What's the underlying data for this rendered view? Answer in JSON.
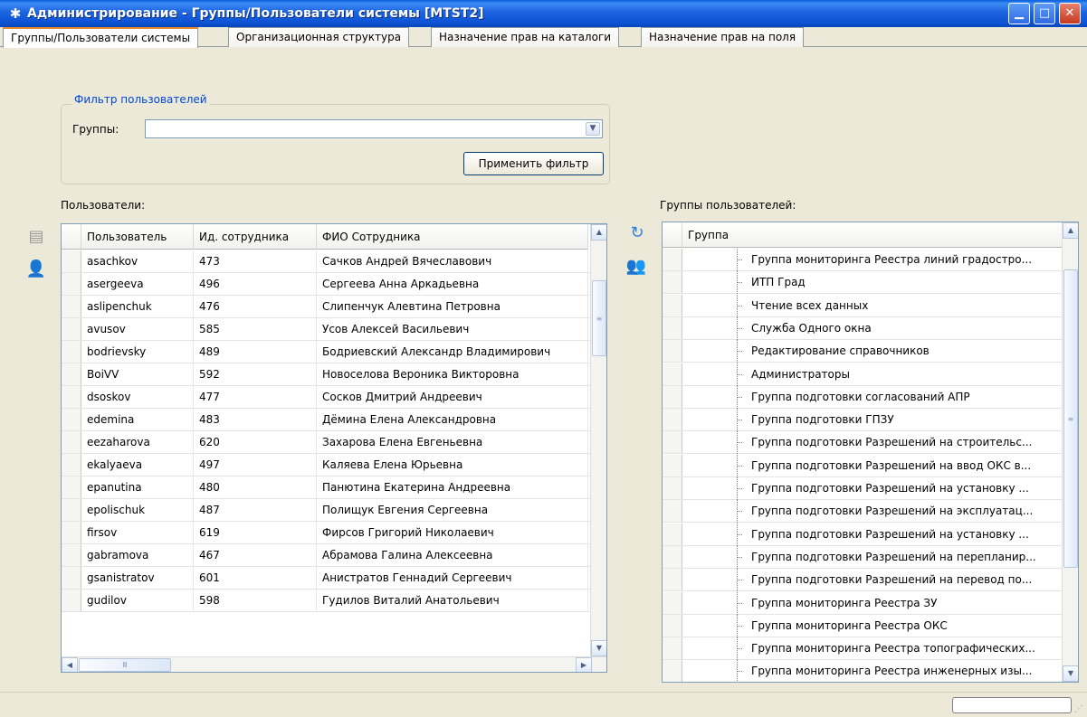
{
  "window": {
    "title": "Администрирование - Группы/Пользователи системы [MTST2]",
    "controls": {
      "minimize": "▁",
      "maximize": "□",
      "close": "✕"
    }
  },
  "tabs": [
    {
      "label": "Группы/Пользователи системы",
      "active": true
    },
    {
      "label": "Организационная структура",
      "active": false
    },
    {
      "label": "Назначение прав на каталоги",
      "active": false
    },
    {
      "label": "Назначение прав на поля",
      "active": false
    }
  ],
  "filter": {
    "title": "Фильтр пользователей",
    "groups_label": "Группы:",
    "groups_value": "",
    "apply_label": "Применить фильтр"
  },
  "users": {
    "label": "Пользователи:",
    "columns": [
      "Пользователь",
      "Ид. сотрудника",
      "ФИО Сотрудника"
    ],
    "rows": [
      {
        "login": "asachkov",
        "id": "473",
        "name": "Сачков Андрей Вячеславович"
      },
      {
        "login": "asergeeva",
        "id": "496",
        "name": "Сергеева Анна Аркадьевна"
      },
      {
        "login": "aslipenchuk",
        "id": "476",
        "name": "Слипенчук Алевтина Петровна"
      },
      {
        "login": "avusov",
        "id": "585",
        "name": "Усов Алексей Васильевич"
      },
      {
        "login": "bodrievsky",
        "id": "489",
        "name": "Бодриевский Александр Владимирович"
      },
      {
        "login": "BoiVV",
        "id": "592",
        "name": "Новоселова Вероника Викторовна"
      },
      {
        "login": "dsoskov",
        "id": "477",
        "name": "Сосков Дмитрий Андреевич"
      },
      {
        "login": "edemina",
        "id": "483",
        "name": "Дёмина Елена Александровна"
      },
      {
        "login": "eezaharova",
        "id": "620",
        "name": "Захарова Елена Евгеньевна"
      },
      {
        "login": "ekalyaeva",
        "id": "497",
        "name": "Каляева Елена Юрьевна"
      },
      {
        "login": "epanutina",
        "id": "480",
        "name": "Панютина Екатерина Андреевна"
      },
      {
        "login": "epolischuk",
        "id": "487",
        "name": "Полищук Евгения Сергеевна"
      },
      {
        "login": "firsov",
        "id": "619",
        "name": "Фирсов Григорий Николаевич"
      },
      {
        "login": "gabramova",
        "id": "467",
        "name": "Абрамова Галина Алексеевна"
      },
      {
        "login": "gsanistratov",
        "id": "601",
        "name": "Анистратов Геннадий Сергеевич"
      },
      {
        "login": "gudilov",
        "id": "598",
        "name": "Гудилов Виталий Анатольевич"
      }
    ]
  },
  "groups": {
    "label": "Группы пользователей:",
    "column": "Группа",
    "rows": [
      "Группа мониторинга Реестра линий градостро...",
      "ИТП Град",
      "Чтение всех данных",
      "Служба Одного окна",
      "Редактирование справочников",
      "Администраторы",
      "Группа подготовки согласований АПР",
      "Группа подготовки  ГПЗУ",
      "Группа подготовки Разрешений на строительс...",
      "Группа подготовки Разрешений на ввод ОКС в...",
      "Группа подготовки Разрешений на установку ...",
      "Группа подготовки Разрешений на эксплуатац...",
      "Группа подготовки Разрешений на установку ...",
      "Группа подготовки Разрешений на перепланир...",
      "Группа подготовки Разрешений на перевод по...",
      "Группа мониторинга Реестра ЗУ",
      "Группа мониторинга Реестра ОКС",
      "Группа мониторинга Реестра топографических...",
      "Группа мониторинга Реестра инженерных изы..."
    ]
  },
  "icons": {
    "save": "save-icon",
    "add_user": "add-user-icon",
    "refresh": "refresh-icon",
    "add_users_group": "add-users-icon"
  },
  "colors": {
    "title_bar": "#0d52d3",
    "window_bg": "#ece9d8",
    "group_title": "#0046d5",
    "active_tab_highlight": "#e68b2c"
  }
}
